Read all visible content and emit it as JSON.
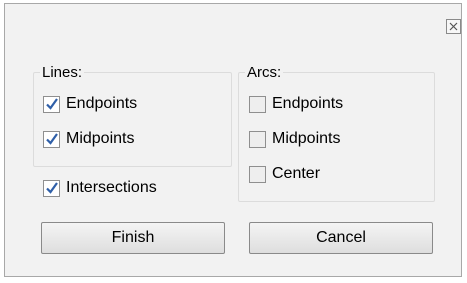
{
  "dialog": {
    "close_icon": "close-icon"
  },
  "lines_group": {
    "title": "Lines:",
    "options": [
      {
        "label": "Endpoints",
        "checked": true
      },
      {
        "label": "Midpoints",
        "checked": true
      }
    ]
  },
  "intersections": {
    "label": "Intersections",
    "checked": true
  },
  "arcs_group": {
    "title": "Arcs:",
    "options": [
      {
        "label": "Endpoints",
        "checked": false
      },
      {
        "label": "Midpoints",
        "checked": false
      },
      {
        "label": "Center",
        "checked": false
      }
    ]
  },
  "buttons": {
    "finish": "Finish",
    "cancel": "Cancel"
  },
  "colors": {
    "checkmark": "#2f5fa8",
    "dialog_bg": "#f2f2f2"
  }
}
